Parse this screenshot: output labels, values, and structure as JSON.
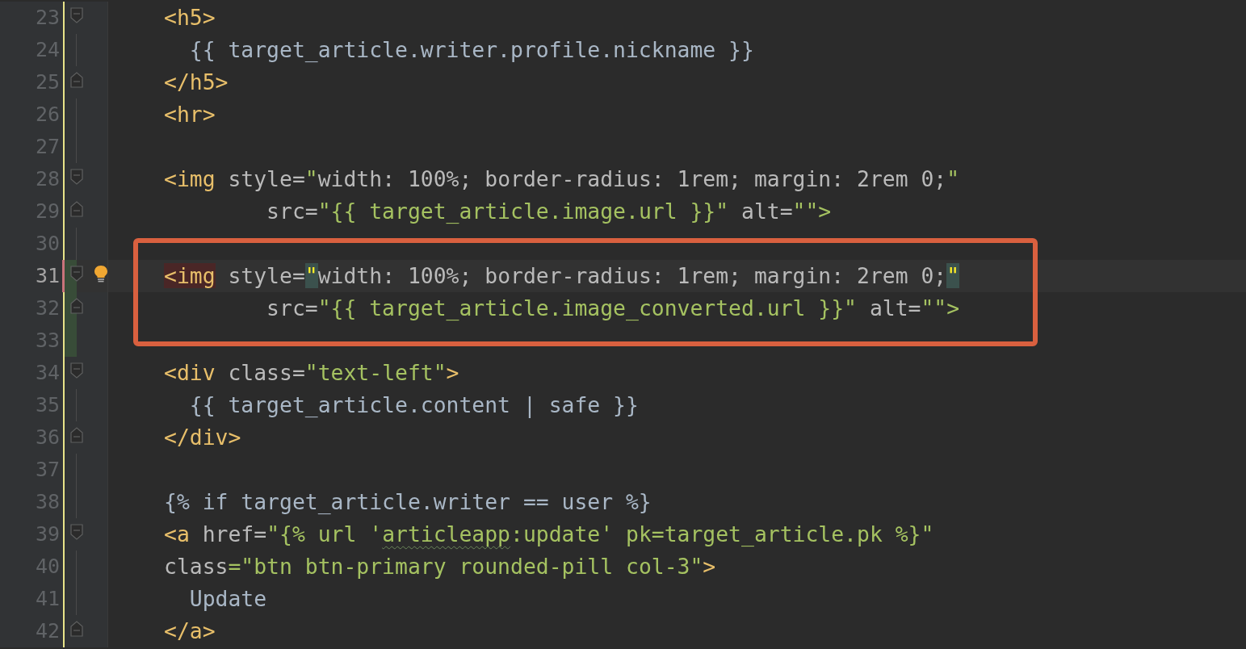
{
  "lines_before": [
    {
      "number": "23",
      "fold_start": true,
      "fold_end": false,
      "current": false,
      "added": false,
      "modified": false,
      "bulb": false,
      "tokens": [
        {
          "kind": "tag",
          "text": "<h5>"
        }
      ]
    },
    {
      "number": "24",
      "fold_start": false,
      "fold_end": false,
      "current": false,
      "added": false,
      "modified": false,
      "bulb": false,
      "tokens": [
        {
          "kind": "text",
          "text": "  {{ target_article.writer.profile.nickname }}"
        }
      ]
    },
    {
      "number": "25",
      "fold_start": false,
      "fold_end": true,
      "current": false,
      "added": false,
      "modified": false,
      "bulb": false,
      "tokens": [
        {
          "kind": "tag",
          "text": "</h5>"
        }
      ]
    },
    {
      "number": "26",
      "fold_start": false,
      "fold_end": false,
      "current": false,
      "added": false,
      "modified": false,
      "bulb": false,
      "tokens": [
        {
          "kind": "tag",
          "text": "<hr>"
        }
      ]
    },
    {
      "number": "27",
      "fold_start": false,
      "fold_end": false,
      "current": false,
      "added": false,
      "modified": false,
      "bulb": false
    },
    {
      "number": "28",
      "fold_start": true,
      "fold_end": false,
      "current": false,
      "added": false,
      "modified": false,
      "bulb": false,
      "tokens": [
        {
          "kind": "tag",
          "text": "<img"
        },
        {
          "kind": "attr",
          "text": " style="
        },
        {
          "kind": "string",
          "text": "\""
        },
        {
          "kind": "attr",
          "text": "width: 100%; border-radius: 1rem; margin: 2rem 0;"
        },
        {
          "kind": "string",
          "text": "\""
        }
      ]
    },
    {
      "number": "29",
      "fold_start": false,
      "fold_end": true,
      "current": false,
      "added": false,
      "modified": false,
      "bulb": false,
      "tokens": [
        {
          "kind": "attr",
          "text": "        src="
        },
        {
          "kind": "string",
          "text": "\"{{ target_article.image.url }}\""
        },
        {
          "kind": "attr",
          "text": " alt="
        },
        {
          "kind": "string",
          "text": "\"\">"
        }
      ]
    },
    {
      "number": "30",
      "fold_start": false,
      "fold_end": false,
      "current": false,
      "added": false,
      "modified": false,
      "bulb": false
    }
  ],
  "highlight_box": {
    "lines": [
      {
        "number": "31",
        "fold_start": true,
        "fold_end": false,
        "current": true,
        "added": true,
        "modified": true,
        "bulb": true,
        "tokens": [
          {
            "kind": "tag-error",
            "text": "<img"
          },
          {
            "kind": "attr",
            "text": " style="
          },
          {
            "kind": "quote-match",
            "text": "\""
          },
          {
            "kind": "attr",
            "text": "width: 100%; border-radius: 1rem; margin: 2rem 0;"
          },
          {
            "kind": "quote-match",
            "text": "\""
          }
        ]
      },
      {
        "number": "32",
        "fold_start": false,
        "fold_end": true,
        "current": false,
        "added": true,
        "modified": false,
        "bulb": false,
        "tokens": [
          {
            "kind": "attr",
            "text": "        src="
          },
          {
            "kind": "string",
            "text": "\"{{ target_article.image_converted.url }}\""
          },
          {
            "kind": "attr",
            "text": " alt="
          },
          {
            "kind": "string",
            "text": "\"\">"
          }
        ]
      }
    ]
  },
  "lines_after": [
    {
      "number": "33",
      "fold_start": false,
      "fold_end": false,
      "current": false,
      "added": true,
      "modified": false,
      "bulb": false
    },
    {
      "number": "34",
      "fold_start": true,
      "fold_end": false,
      "current": false,
      "added": false,
      "modified": false,
      "bulb": false,
      "tokens": [
        {
          "kind": "tag",
          "text": "<div"
        },
        {
          "kind": "attr",
          "text": " class="
        },
        {
          "kind": "string",
          "text": "\"text-left\""
        },
        {
          "kind": "tag",
          "text": ">"
        }
      ]
    },
    {
      "number": "35",
      "fold_start": false,
      "fold_end": false,
      "current": false,
      "added": false,
      "modified": false,
      "bulb": false,
      "tokens": [
        {
          "kind": "text",
          "text": "  {{ target_article.content | safe }}"
        }
      ]
    },
    {
      "number": "36",
      "fold_start": false,
      "fold_end": true,
      "current": false,
      "added": false,
      "modified": false,
      "bulb": false,
      "tokens": [
        {
          "kind": "tag",
          "text": "</div>"
        }
      ]
    },
    {
      "number": "37",
      "fold_start": false,
      "fold_end": false,
      "current": false,
      "added": false,
      "modified": false,
      "bulb": false
    },
    {
      "number": "38",
      "fold_start": false,
      "fold_end": false,
      "current": false,
      "added": false,
      "modified": false,
      "bulb": false,
      "tokens": [
        {
          "kind": "text",
          "text": "{% if target_article.writer == user %}"
        }
      ]
    },
    {
      "number": "39",
      "fold_start": true,
      "fold_end": false,
      "current": false,
      "added": false,
      "modified": false,
      "bulb": false,
      "tokens": [
        {
          "kind": "tag",
          "text": "<a"
        },
        {
          "kind": "attr",
          "text": " href="
        },
        {
          "kind": "string",
          "text": "\"{% url '"
        },
        {
          "kind": "string-typo",
          "text": "articleapp"
        },
        {
          "kind": "string",
          "text": ":update' pk=target_article.pk %}\""
        }
      ]
    },
    {
      "number": "40",
      "fold_start": false,
      "fold_end": false,
      "current": false,
      "added": false,
      "modified": false,
      "bulb": false,
      "tokens": [
        {
          "kind": "attr",
          "text": "class"
        },
        {
          "kind": "string",
          "text": "=\"btn btn-primary rounded-pill col-3\""
        },
        {
          "kind": "tag",
          "text": ">"
        }
      ]
    },
    {
      "number": "41",
      "fold_start": false,
      "fold_end": false,
      "current": false,
      "added": false,
      "modified": false,
      "bulb": false,
      "tokens": [
        {
          "kind": "text",
          "text": "  Update"
        }
      ]
    },
    {
      "number": "42",
      "fold_start": false,
      "fold_end": true,
      "current": false,
      "added": false,
      "modified": false,
      "bulb": false,
      "tokens": [
        {
          "kind": "tag",
          "text": "</a>"
        }
      ]
    }
  ]
}
